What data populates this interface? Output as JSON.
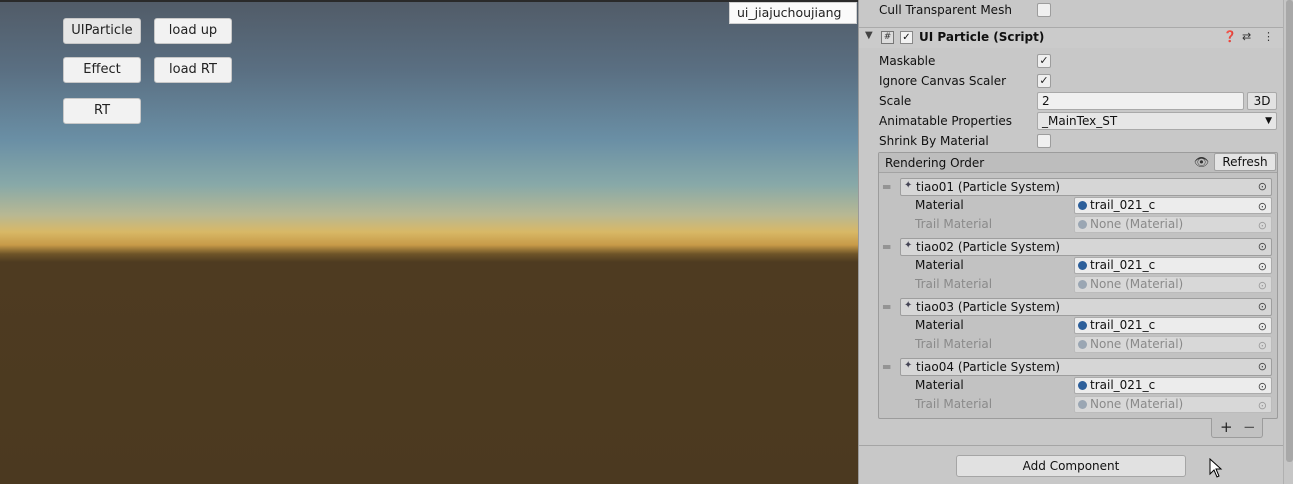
{
  "game": {
    "buttons": {
      "uiparticle": "UIParticle",
      "load_up": "load up",
      "effect": "Effect",
      "load_rt": "load RT",
      "rt": "RT"
    },
    "object_label": "ui_jiajuchoujiang"
  },
  "inspector": {
    "cull_transparent_mesh": {
      "label": "Cull Transparent Mesh",
      "checked": false
    },
    "component": {
      "title": "UI Particle (Script)",
      "enabled": true,
      "icons": [
        "help-icon",
        "preset-icon",
        "more-icon"
      ]
    },
    "maskable": {
      "label": "Maskable",
      "checked": true
    },
    "ignore_canvas_scaler": {
      "label": "Ignore Canvas Scaler",
      "checked": true
    },
    "scale": {
      "label": "Scale",
      "value": "2",
      "mode_button": "3D"
    },
    "animatable_properties": {
      "label": "Animatable Properties",
      "value": "_MainTex_ST"
    },
    "shrink_by_material": {
      "label": "Shrink By Material",
      "checked": false
    },
    "rendering_order": {
      "title": "Rendering Order",
      "refresh_label": "Refresh",
      "material_label": "Material",
      "trail_material_label": "Trail Material",
      "items": [
        {
          "name": "tiao01 (Particle System)",
          "material": "trail_021_c",
          "trail_material": "None (Material)"
        },
        {
          "name": "tiao02 (Particle System)",
          "material": "trail_021_c",
          "trail_material": "None (Material)"
        },
        {
          "name": "tiao03 (Particle System)",
          "material": "trail_021_c",
          "trail_material": "None (Material)"
        },
        {
          "name": "tiao04 (Particle System)",
          "material": "trail_021_c",
          "trail_material": "None (Material)"
        }
      ]
    },
    "add_component": "Add Component"
  },
  "colors": {
    "material_dot": "#2d5f9a",
    "inspector_bg": "#c8c8c8",
    "ground": "#4b3920",
    "horizon": "#d8b866"
  }
}
